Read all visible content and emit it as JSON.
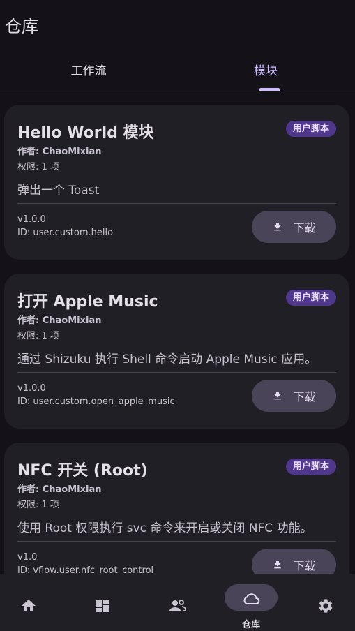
{
  "header": {
    "title": "仓库"
  },
  "tabs": [
    {
      "label": "工作流",
      "active": false
    },
    {
      "label": "模块",
      "active": true
    }
  ],
  "modules": [
    {
      "title": "Hello World 模块",
      "badge": "用户脚本",
      "author": "作者: ChaoMixian",
      "permissions": "权限: 1 项",
      "description": "弹出一个 Toast",
      "version": "v1.0.0",
      "id": "ID: user.custom.hello",
      "download_label": "下载"
    },
    {
      "title": "打开 Apple Music",
      "badge": "用户脚本",
      "author": "作者: ChaoMixian",
      "permissions": "权限: 1 项",
      "description": "通过 Shizuku 执行 Shell 命令启动 Apple Music 应用。",
      "version": "v1.0.0",
      "id": "ID: user.custom.open_apple_music",
      "download_label": "下载"
    },
    {
      "title": "NFC 开关 (Root)",
      "badge": "用户脚本",
      "author": "作者: ChaoMixian",
      "permissions": "权限: 1 项",
      "description": "使用 Root 权限执行 svc 命令来开启或关闭 NFC 功能。",
      "version": "v1.0",
      "id": "ID: vflow.user.nfc_root_control",
      "download_label": "下载"
    }
  ],
  "bottom_nav": {
    "items": [
      {
        "icon": "home-icon",
        "label": ""
      },
      {
        "icon": "dashboard-icon",
        "label": ""
      },
      {
        "icon": "people-icon",
        "label": ""
      },
      {
        "icon": "cloud-icon",
        "label": "仓库",
        "active": true
      },
      {
        "icon": "gear-icon",
        "label": ""
      }
    ]
  },
  "colors": {
    "background": "#141218",
    "card": "#211F26",
    "accent": "#D0BCFF",
    "badge": "#4F378B",
    "button": "#4A4458"
  }
}
